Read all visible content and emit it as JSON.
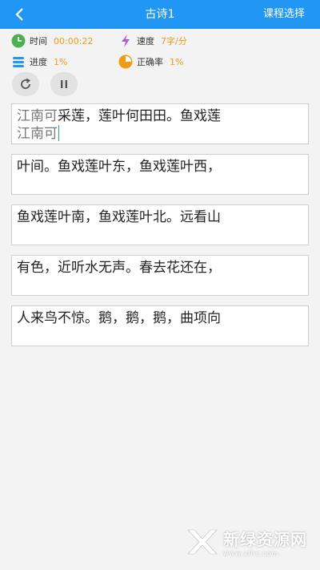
{
  "header": {
    "title": "古诗1",
    "right_label": "课程选择"
  },
  "stats": {
    "time_label": "时间",
    "time_value": "00:00:22",
    "speed_label": "速度",
    "speed_value": "7字/分",
    "progress_label": "进度",
    "progress_value": "1%",
    "accuracy_label": "正确率",
    "accuracy_value": "1%"
  },
  "poem": {
    "line1_done": "江南可",
    "line1_rest": "采莲，莲叶何田田。鱼戏莲",
    "line1_typed": "江南可",
    "line2": "叶间。鱼戏莲叶东，鱼戏莲叶西，",
    "line3": "鱼戏莲叶南，鱼戏莲叶北。远看山",
    "line4": "有色，近听水无声。春去花还在，",
    "line5": "人来鸟不惊。鹅，鹅，鹅，曲项向"
  },
  "watermark": {
    "name": "新绿资源网",
    "url": "www.xlhs.com"
  },
  "colors": {
    "accent": "#2196f3",
    "value": "#f29a12",
    "clock": "#4caf50",
    "speed": "#b05ad8",
    "chart": "#f29a12"
  }
}
